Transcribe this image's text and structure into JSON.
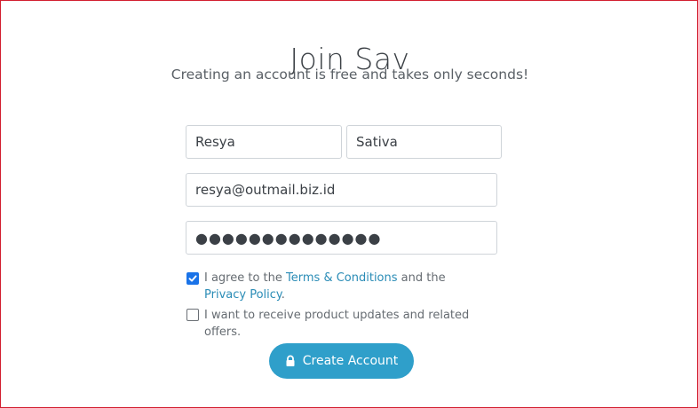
{
  "page": {
    "title": "Join Sav",
    "subtitle": "Creating an account is free and takes only seconds!"
  },
  "form": {
    "first_name": {
      "value": "Resya"
    },
    "last_name": {
      "value": "Sativa"
    },
    "email": {
      "value": "resya@outmail.biz.id"
    },
    "password": {
      "masked_value": "●●●●●●●●●●●●●●"
    },
    "agree_terms": {
      "checked": true,
      "prefix": "I agree to the ",
      "terms_link": "Terms & Conditions",
      "middle": " and the ",
      "privacy_link": "Privacy Policy",
      "suffix": "."
    },
    "updates_opt_in": {
      "checked": false,
      "label": "I want to receive product updates and related offers."
    },
    "submit": {
      "label": "Create Account",
      "icon": "lock-icon"
    }
  },
  "colors": {
    "frame_border": "#d21f2f",
    "link": "#2a8cb6",
    "checkbox_checked": "#1a73e8",
    "button_background": "#2f9fca",
    "button_text": "#ffffff"
  }
}
